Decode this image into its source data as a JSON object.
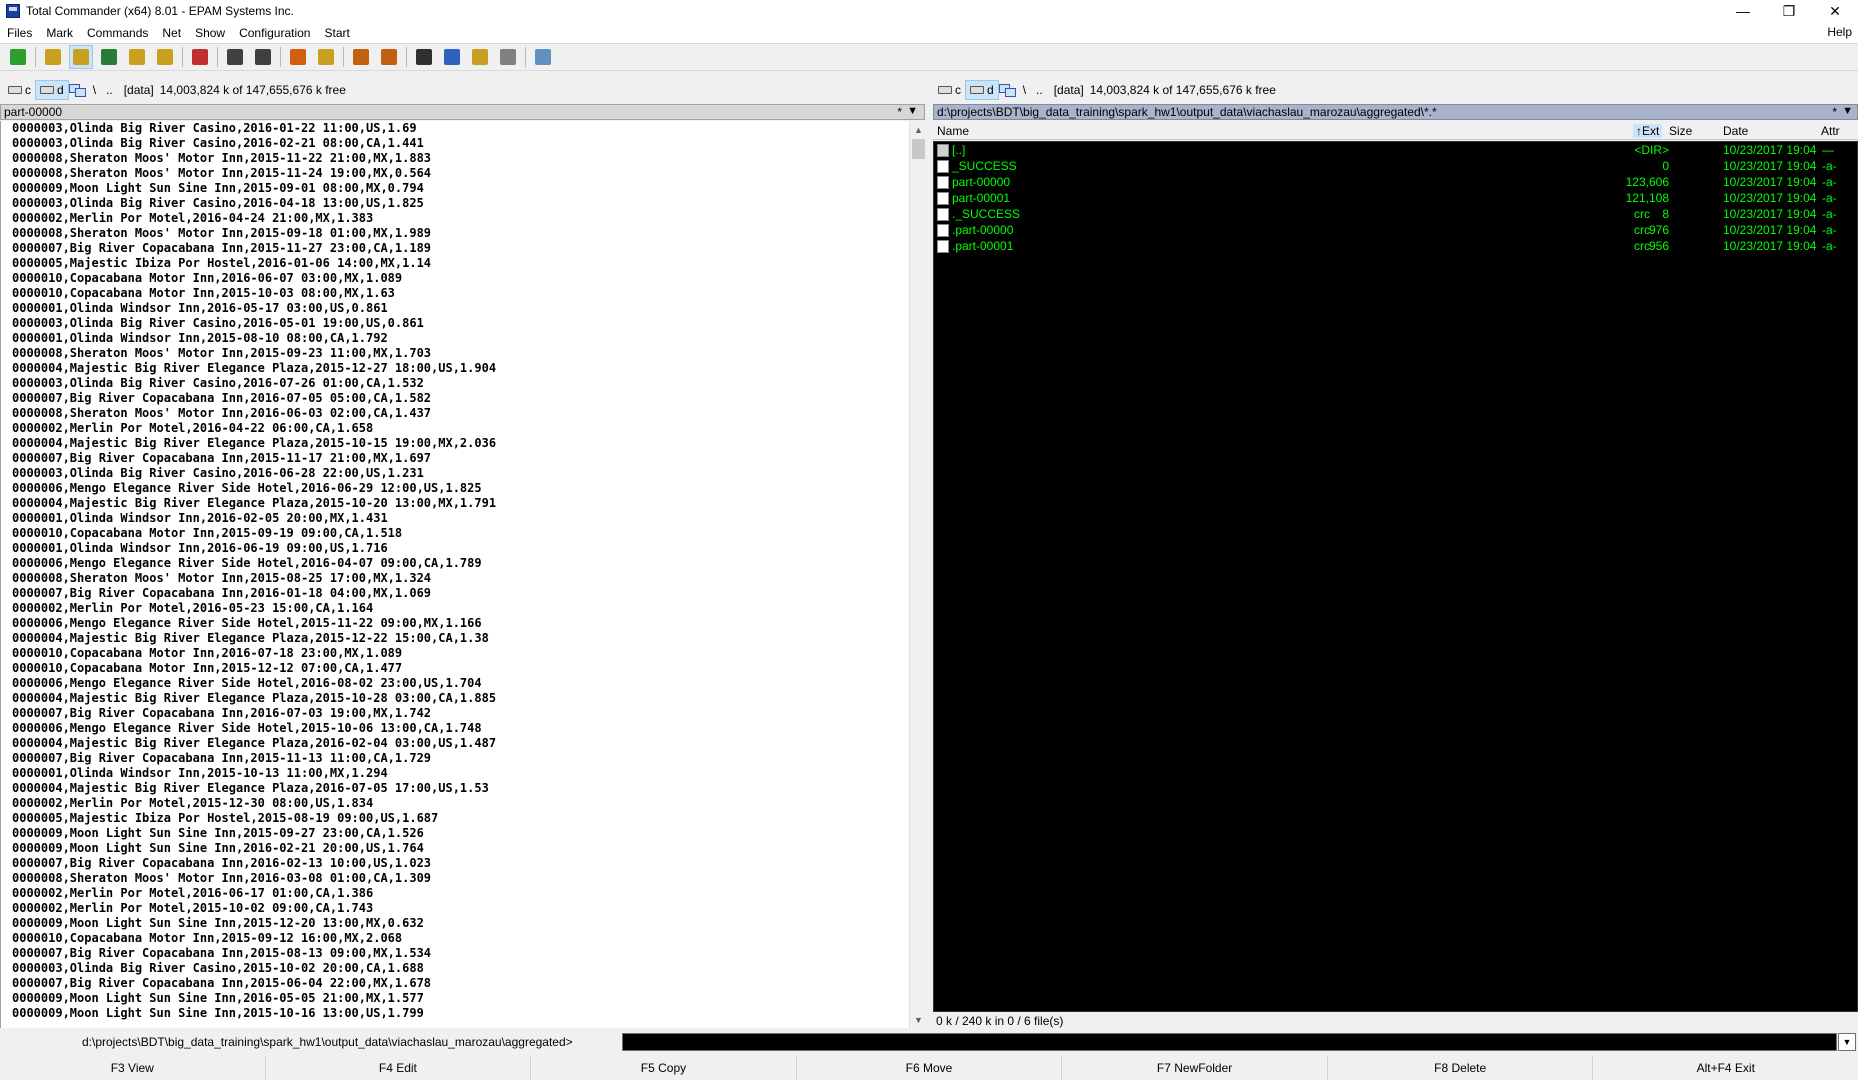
{
  "window": {
    "title": "Total Commander (x64) 8.01 - EPAM Systems Inc.",
    "controls": {
      "minimize": "—",
      "restore": "❐",
      "close": "✕"
    }
  },
  "menu": {
    "items": [
      "Files",
      "Mark",
      "Commands",
      "Net",
      "Show",
      "Configuration",
      "Start"
    ],
    "help": "Help"
  },
  "toolbar": {
    "icons": [
      {
        "name": "refresh-icon",
        "color": "#2e9e2e"
      },
      {
        "name": "brief-view-icon",
        "color": "#c8a020"
      },
      {
        "name": "full-view-icon",
        "color": "#c8a020"
      },
      {
        "name": "thumbnails-icon",
        "color": "#2a7a3a"
      },
      {
        "name": "tree-icon",
        "color": "#c8a020"
      },
      {
        "name": "invert-selection-icon",
        "color": "#c8a020"
      },
      {
        "name": "compare-icon",
        "color": "#c03030"
      },
      {
        "name": "back-icon",
        "color": "#404040"
      },
      {
        "name": "forward-icon",
        "color": "#404040"
      },
      {
        "name": "pack-icon",
        "color": "#d06010"
      },
      {
        "name": "unpack-icon",
        "color": "#c8a020"
      },
      {
        "name": "ftp-connect-icon",
        "color": "#c06010"
      },
      {
        "name": "url-connect-icon",
        "color": "#c06010"
      },
      {
        "name": "search-icon",
        "color": "#303030"
      },
      {
        "name": "multi-rename-icon",
        "color": "#3060c0"
      },
      {
        "name": "sync-dirs-icon",
        "color": "#c8a020"
      },
      {
        "name": "sync-compare-icon",
        "color": "#808080"
      },
      {
        "name": "notepad-icon",
        "color": "#6090c0"
      }
    ]
  },
  "left": {
    "drive_c": "c",
    "drive_d": "d",
    "root": "\\",
    "up": "..",
    "volume": "[data]",
    "free": "14,003,824 k of 147,655,676 k free",
    "path_label": "part-00000",
    "star": "*",
    "history": "▼",
    "lines": [
      "0000003,Olinda Big River Casino,2016-01-22 11:00,US,1.69",
      "0000003,Olinda Big River Casino,2016-02-21 08:00,CA,1.441",
      "0000008,Sheraton Moos' Motor Inn,2015-11-22 21:00,MX,1.883",
      "0000008,Sheraton Moos' Motor Inn,2015-11-24 19:00,MX,0.564",
      "0000009,Moon Light Sun Sine Inn,2015-09-01 08:00,MX,0.794",
      "0000003,Olinda Big River Casino,2016-04-18 13:00,US,1.825",
      "0000002,Merlin Por Motel,2016-04-24 21:00,MX,1.383",
      "0000008,Sheraton Moos' Motor Inn,2015-09-18 01:00,MX,1.989",
      "0000007,Big River Copacabana Inn,2015-11-27 23:00,CA,1.189",
      "0000005,Majestic Ibiza Por Hostel,2016-01-06 14:00,MX,1.14",
      "0000010,Copacabana Motor Inn,2016-06-07 03:00,MX,1.089",
      "0000010,Copacabana Motor Inn,2015-10-03 08:00,MX,1.63",
      "0000001,Olinda Windsor Inn,2016-05-17 03:00,US,0.861",
      "0000003,Olinda Big River Casino,2016-05-01 19:00,US,0.861",
      "0000001,Olinda Windsor Inn,2015-08-10 08:00,CA,1.792",
      "0000008,Sheraton Moos' Motor Inn,2015-09-23 11:00,MX,1.703",
      "0000004,Majestic Big River Elegance Plaza,2015-12-27 18:00,US,1.904",
      "0000003,Olinda Big River Casino,2016-07-26 01:00,CA,1.532",
      "0000007,Big River Copacabana Inn,2016-07-05 05:00,CA,1.582",
      "0000008,Sheraton Moos' Motor Inn,2016-06-03 02:00,CA,1.437",
      "0000002,Merlin Por Motel,2016-04-22 06:00,CA,1.658",
      "0000004,Majestic Big River Elegance Plaza,2015-10-15 19:00,MX,2.036",
      "0000007,Big River Copacabana Inn,2015-11-17 21:00,MX,1.697",
      "0000003,Olinda Big River Casino,2016-06-28 22:00,US,1.231",
      "0000006,Mengo Elegance River Side Hotel,2016-06-29 12:00,US,1.825",
      "0000004,Majestic Big River Elegance Plaza,2015-10-20 13:00,MX,1.791",
      "0000001,Olinda Windsor Inn,2016-02-05 20:00,MX,1.431",
      "0000010,Copacabana Motor Inn,2015-09-19 09:00,CA,1.518",
      "0000001,Olinda Windsor Inn,2016-06-19 09:00,US,1.716",
      "0000006,Mengo Elegance River Side Hotel,2016-04-07 09:00,CA,1.789",
      "0000008,Sheraton Moos' Motor Inn,2015-08-25 17:00,MX,1.324",
      "0000007,Big River Copacabana Inn,2016-01-18 04:00,MX,1.069",
      "0000002,Merlin Por Motel,2016-05-23 15:00,CA,1.164",
      "0000006,Mengo Elegance River Side Hotel,2015-11-22 09:00,MX,1.166",
      "0000004,Majestic Big River Elegance Plaza,2015-12-22 15:00,CA,1.38",
      "0000010,Copacabana Motor Inn,2016-07-18 23:00,MX,1.089",
      "0000010,Copacabana Motor Inn,2015-12-12 07:00,CA,1.477",
      "0000006,Mengo Elegance River Side Hotel,2016-08-02 23:00,US,1.704",
      "0000004,Majestic Big River Elegance Plaza,2015-10-28 03:00,CA,1.885",
      "0000007,Big River Copacabana Inn,2016-07-03 19:00,MX,1.742",
      "0000006,Mengo Elegance River Side Hotel,2015-10-06 13:00,CA,1.748",
      "0000004,Majestic Big River Elegance Plaza,2016-02-04 03:00,US,1.487",
      "0000007,Big River Copacabana Inn,2015-11-13 11:00,CA,1.729",
      "0000001,Olinda Windsor Inn,2015-10-13 11:00,MX,1.294",
      "0000004,Majestic Big River Elegance Plaza,2016-07-05 17:00,US,1.53",
      "0000002,Merlin Por Motel,2015-12-30 08:00,US,1.834",
      "0000005,Majestic Ibiza Por Hostel,2015-08-19 09:00,US,1.687",
      "0000009,Moon Light Sun Sine Inn,2015-09-27 23:00,CA,1.526",
      "0000009,Moon Light Sun Sine Inn,2016-02-21 20:00,US,1.764",
      "0000007,Big River Copacabana Inn,2016-02-13 10:00,US,1.023",
      "0000008,Sheraton Moos' Motor Inn,2016-03-08 01:00,CA,1.309",
      "0000002,Merlin Por Motel,2016-06-17 01:00,CA,1.386",
      "0000002,Merlin Por Motel,2015-10-02 09:00,CA,1.743",
      "0000009,Moon Light Sun Sine Inn,2015-12-20 13:00,MX,0.632",
      "0000010,Copacabana Motor Inn,2015-09-12 16:00,MX,2.068",
      "0000007,Big River Copacabana Inn,2015-08-13 09:00,MX,1.534",
      "0000003,Olinda Big River Casino,2015-10-02 20:00,CA,1.688",
      "0000007,Big River Copacabana Inn,2015-06-04 22:00,MX,1.678",
      "0000009,Moon Light Sun Sine Inn,2016-05-05 21:00,MX,1.577",
      "0000009,Moon Light Sun Sine Inn,2015-10-16 13:00,US,1.799"
    ]
  },
  "right": {
    "drive_c": "c",
    "drive_d": "d",
    "root": "\\",
    "up": "..",
    "volume": "[data]",
    "free": "14,003,824 k of 147,655,676 k free",
    "path": "d:\\projects\\BDT\\big_data_training\\spark_hw1\\output_data\\viachaslau_marozau\\aggregated\\*.*",
    "star": "*",
    "history": "▼",
    "columns": {
      "name": "Name",
      "ext": "↑Ext",
      "size": "Size",
      "date": "Date",
      "attr": "Attr"
    },
    "files": [
      {
        "name": "[..]",
        "ext": "",
        "size": "<DIR>",
        "date": "10/23/2017 19:04",
        "attr": "—",
        "up": true
      },
      {
        "name": "_SUCCESS",
        "ext": "",
        "size": "0",
        "date": "10/23/2017 19:04",
        "attr": "-a-"
      },
      {
        "name": "part-00000",
        "ext": "",
        "size": "123,606",
        "date": "10/23/2017 19:04",
        "attr": "-a-"
      },
      {
        "name": "part-00001",
        "ext": "",
        "size": "121,108",
        "date": "10/23/2017 19:04",
        "attr": "-a-"
      },
      {
        "name": "._SUCCESS",
        "ext": "crc",
        "size": "8",
        "date": "10/23/2017 19:04",
        "attr": "-a-"
      },
      {
        "name": ".part-00000",
        "ext": "crc",
        "size": "976",
        "date": "10/23/2017 19:04",
        "attr": "-a-"
      },
      {
        "name": ".part-00001",
        "ext": "crc",
        "size": "956",
        "date": "10/23/2017 19:04",
        "attr": "-a-"
      }
    ],
    "status": "0 k / 240 k in 0 / 6 file(s)"
  },
  "cmdline": {
    "path": "d:\\projects\\BDT\\big_data_training\\spark_hw1\\output_data\\viachaslau_marozau\\aggregated>",
    "value": ""
  },
  "fkeys": [
    "F3 View",
    "F4 Edit",
    "F5 Copy",
    "F6 Move",
    "F7 NewFolder",
    "F8 Delete",
    "Alt+F4 Exit"
  ]
}
